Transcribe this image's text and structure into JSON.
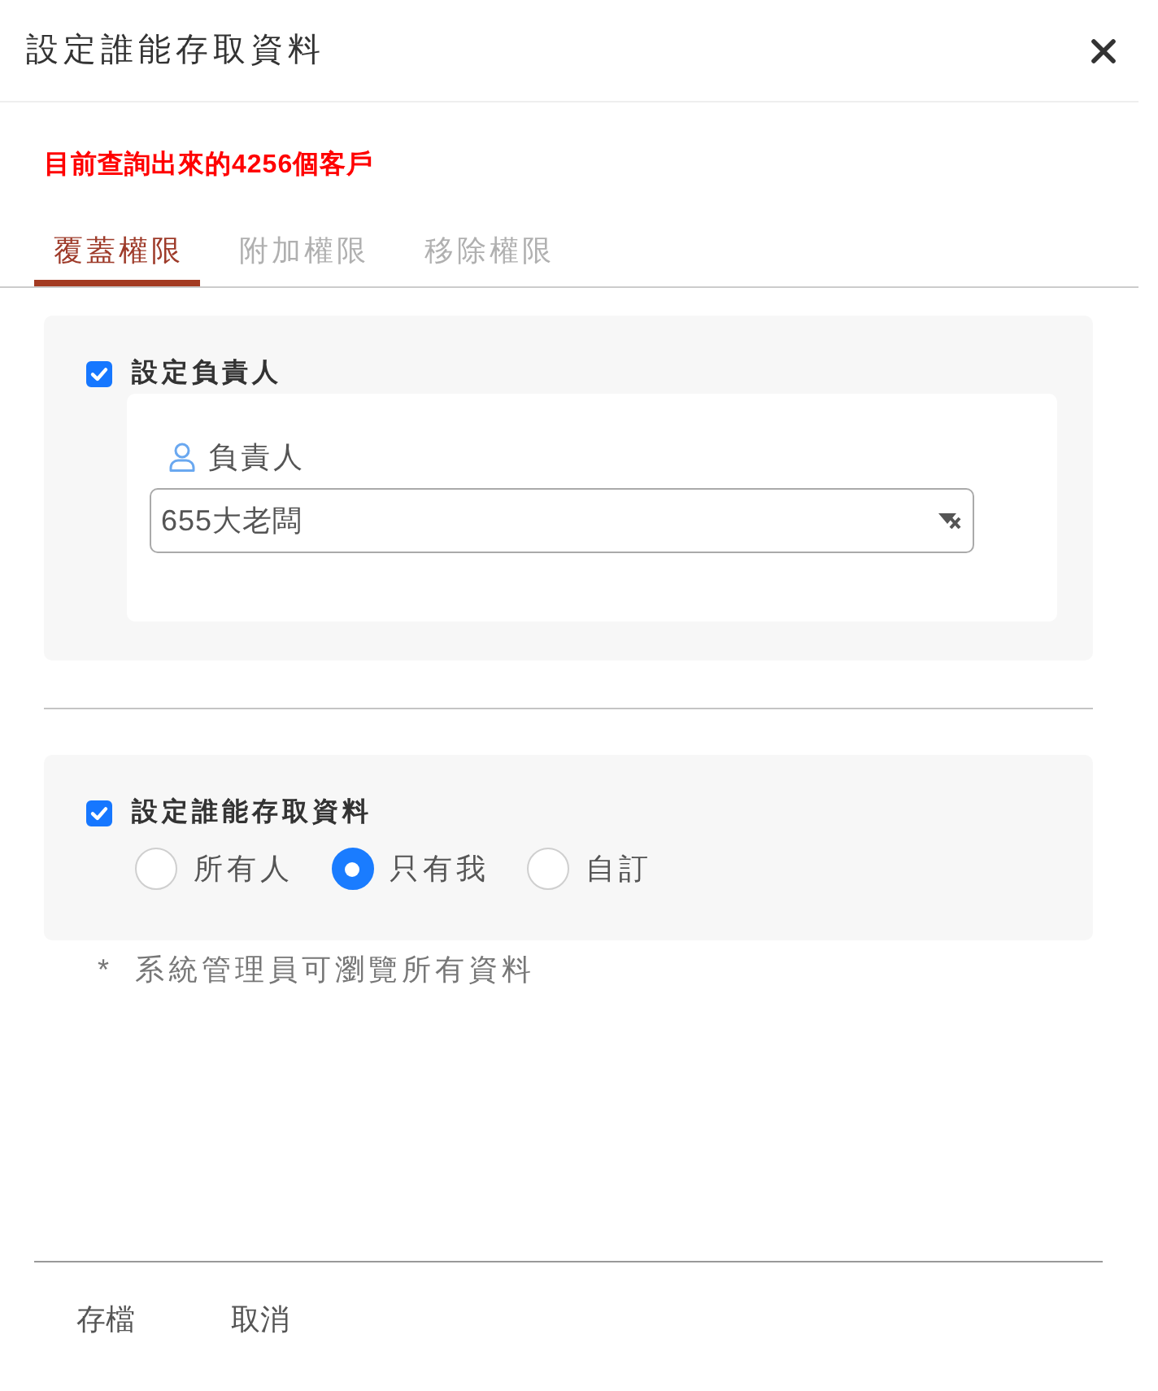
{
  "dialog": {
    "title": "設定誰能存取資料"
  },
  "notice": "目前查詢出來的4256個客戶",
  "tabs": [
    {
      "label": "覆蓋權限",
      "selected": true
    },
    {
      "label": "附加權限",
      "selected": false
    },
    {
      "label": "移除權限",
      "selected": false
    }
  ],
  "owner_section": {
    "label": "設定負責人",
    "checked": true,
    "field": {
      "label": "負責人",
      "value": "655大老闆"
    }
  },
  "access_section": {
    "label": "設定誰能存取資料",
    "checked": true,
    "options": [
      {
        "label": "所有人",
        "selected": false
      },
      {
        "label": "只有我",
        "selected": true
      },
      {
        "label": "自訂",
        "selected": false
      }
    ]
  },
  "note": "* 系統管理員可瀏覽所有資料",
  "buttons": [
    "存檔",
    "取消"
  ]
}
